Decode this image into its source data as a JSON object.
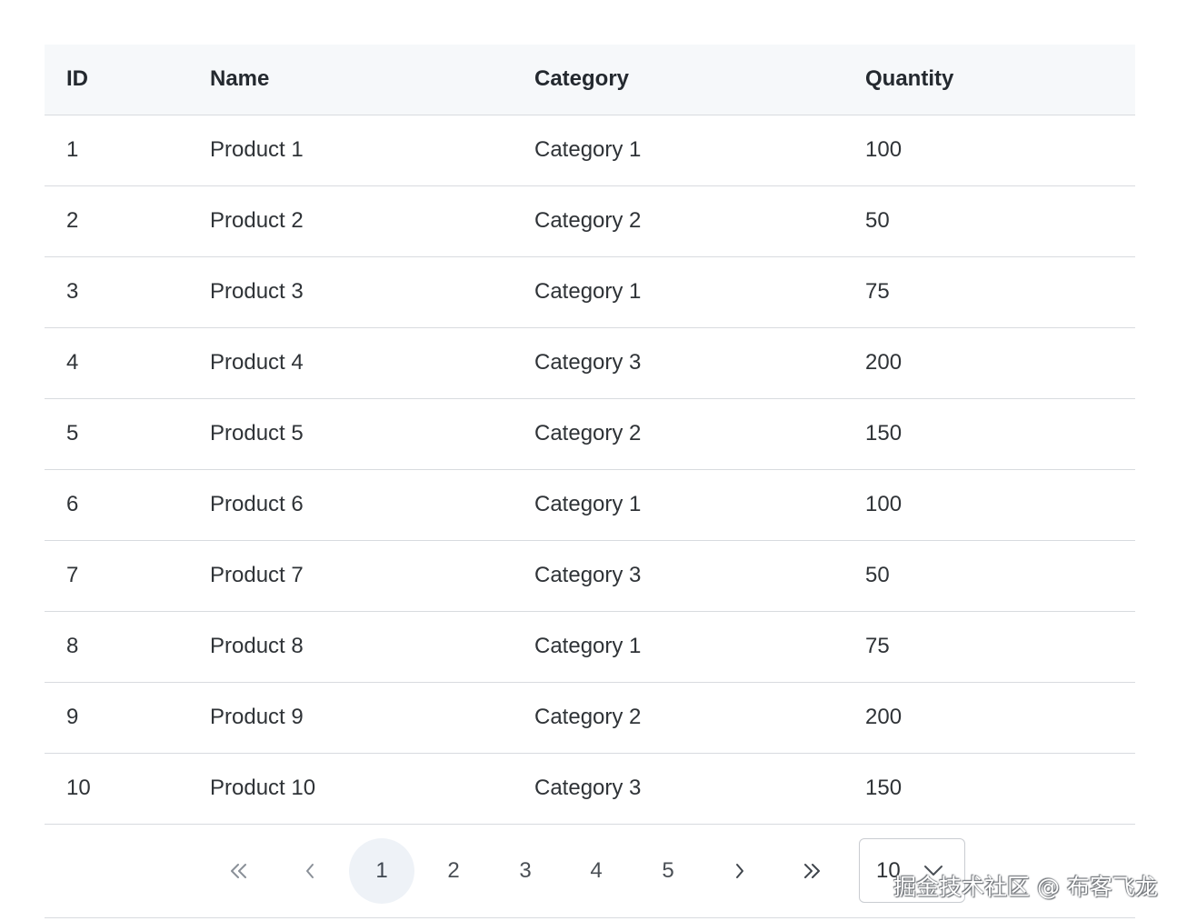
{
  "table": {
    "columns": [
      "ID",
      "Name",
      "Category",
      "Quantity"
    ],
    "rows": [
      [
        "1",
        "Product 1",
        "Category 1",
        "100"
      ],
      [
        "2",
        "Product 2",
        "Category 2",
        "50"
      ],
      [
        "3",
        "Product 3",
        "Category 1",
        "75"
      ],
      [
        "4",
        "Product 4",
        "Category 3",
        "200"
      ],
      [
        "5",
        "Product 5",
        "Category 2",
        "150"
      ],
      [
        "6",
        "Product 6",
        "Category 1",
        "100"
      ],
      [
        "7",
        "Product 7",
        "Category 3",
        "50"
      ],
      [
        "8",
        "Product 8",
        "Category 1",
        "75"
      ],
      [
        "9",
        "Product 9",
        "Category 2",
        "200"
      ],
      [
        "10",
        "Product 10",
        "Category 3",
        "150"
      ]
    ]
  },
  "pagination": {
    "first_icon": "double-chevron-left-icon",
    "prev_icon": "chevron-left-icon",
    "next_icon": "chevron-right-icon",
    "last_icon": "double-chevron-right-icon",
    "pages": [
      "1",
      "2",
      "3",
      "4",
      "5"
    ],
    "active_page": "1",
    "page_size": "10",
    "page_size_icon": "chevron-down-icon"
  },
  "watermark": "掘金技术社区 @ 布客飞龙",
  "colors": {
    "header_bg": "#f6f8fa",
    "border": "#d8dbdf",
    "active_page_bg": "#eef2f7"
  }
}
